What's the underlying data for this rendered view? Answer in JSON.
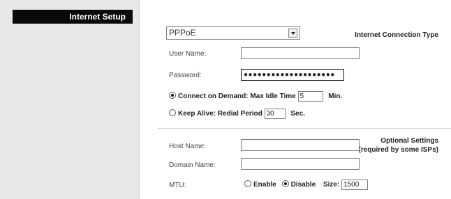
{
  "section": {
    "title": "Internet Setup",
    "connection_type_label": "Internet Connection Type",
    "optional_label_line1": "Optional Settings",
    "optional_label_line2": "(required by some ISPs)"
  },
  "connection": {
    "selected": "PPPoE"
  },
  "pppoe": {
    "username_label": "User Name:",
    "username_value": "",
    "password_label": "Password:",
    "password_value": "●●●●●●●●●●●●●●●●●●●●",
    "connect_on_demand_label": "Connect on Demand: Max Idle Time",
    "connect_on_demand_checked": true,
    "max_idle_time": "5",
    "min_unit": "Min.",
    "keep_alive_label": "Keep Alive: Redial Period",
    "keep_alive_checked": false,
    "redial_period": "30",
    "sec_unit": "Sec."
  },
  "optional": {
    "host_name_label": "Host Name:",
    "host_name_value": "",
    "domain_name_label": "Domain Name:",
    "domain_name_value": "",
    "mtu_label": "MTU:",
    "enable_label": "Enable",
    "disable_label": "Disable",
    "mtu_mode": "Disable",
    "size_label": "Size:",
    "size_value": "1500"
  }
}
